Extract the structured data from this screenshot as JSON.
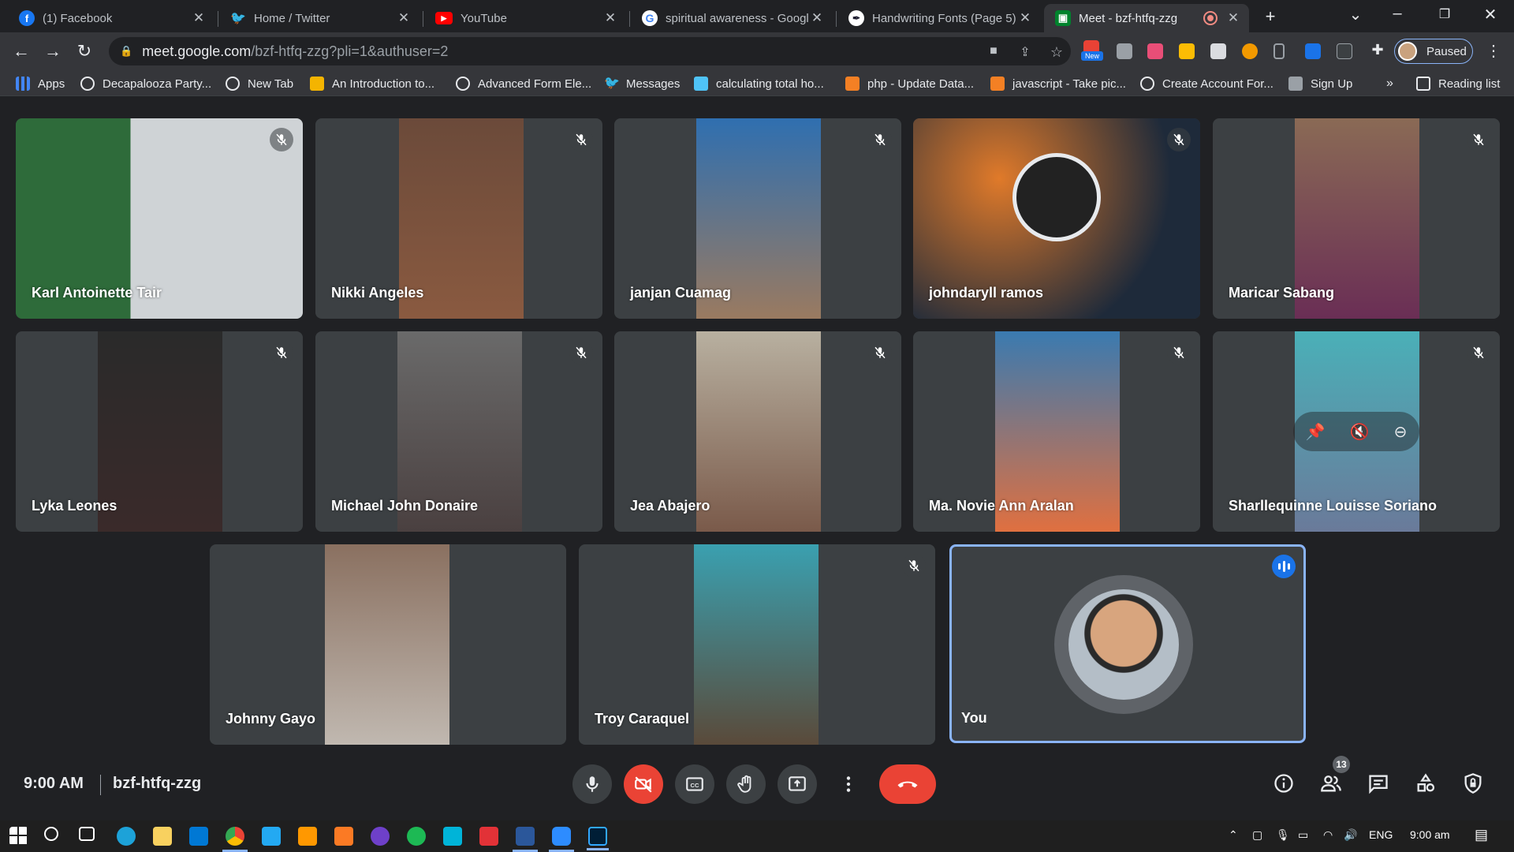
{
  "browser": {
    "tabs": [
      {
        "title": "(1) Facebook",
        "icon": "facebook-icon",
        "color": "#1877f2"
      },
      {
        "title": "Home / Twitter",
        "icon": "twitter-icon",
        "color": "#1d9bf0"
      },
      {
        "title": "YouTube",
        "icon": "youtube-icon",
        "color": "#ff0000"
      },
      {
        "title": "spiritual awareness - Googl",
        "icon": "google-icon",
        "color": "#ffffff"
      },
      {
        "title": "Handwriting Fonts (Page 5)",
        "icon": "fonts-icon",
        "color": "#1b1b2e"
      },
      {
        "title": "Meet - bzf-htfq-zzg",
        "icon": "google-meet-icon",
        "color": "#00832d"
      }
    ],
    "url_host": "meet.google.com",
    "url_path": "/bzf-htfq-zzg?pli=1&authuser=2",
    "profile_label": "Paused",
    "new_badge": "New",
    "bookmarks": [
      "Apps",
      "Decapalooza Party...",
      "New Tab",
      "An Introduction to...",
      "Advanced Form Ele...",
      "Messages",
      "calculating total ho...",
      "php - Update Data...",
      "javascript - Take pic...",
      "Create Account For...",
      "Sign Up"
    ],
    "bookmarks_more": "»",
    "reading_list": "Reading list"
  },
  "meeting": {
    "participants": [
      {
        "name": "Karl Antoinette Tair"
      },
      {
        "name": "Nikki Angeles"
      },
      {
        "name": "janjan Cuamag"
      },
      {
        "name": "johndaryll ramos"
      },
      {
        "name": "Maricar Sabang"
      },
      {
        "name": "Lyka Leones"
      },
      {
        "name": "Michael John Donaire"
      },
      {
        "name": "Jea Abajero"
      },
      {
        "name": "Ma. Novie Ann Aralan"
      },
      {
        "name": "Sharllequinne Louisse Soriano"
      },
      {
        "name": "Johnny Gayo"
      },
      {
        "name": "Troy Caraquel"
      }
    ],
    "self_label": "You",
    "time": "9:00 AM",
    "code": "bzf-htfq-zzg",
    "people_count": "13"
  },
  "taskbar": {
    "lang": "ENG",
    "time": "9:00 am"
  },
  "colors": {
    "accent": "#8ab4f8",
    "danger": "#ea4335",
    "tile": "#3c4043",
    "bg": "#202124"
  }
}
